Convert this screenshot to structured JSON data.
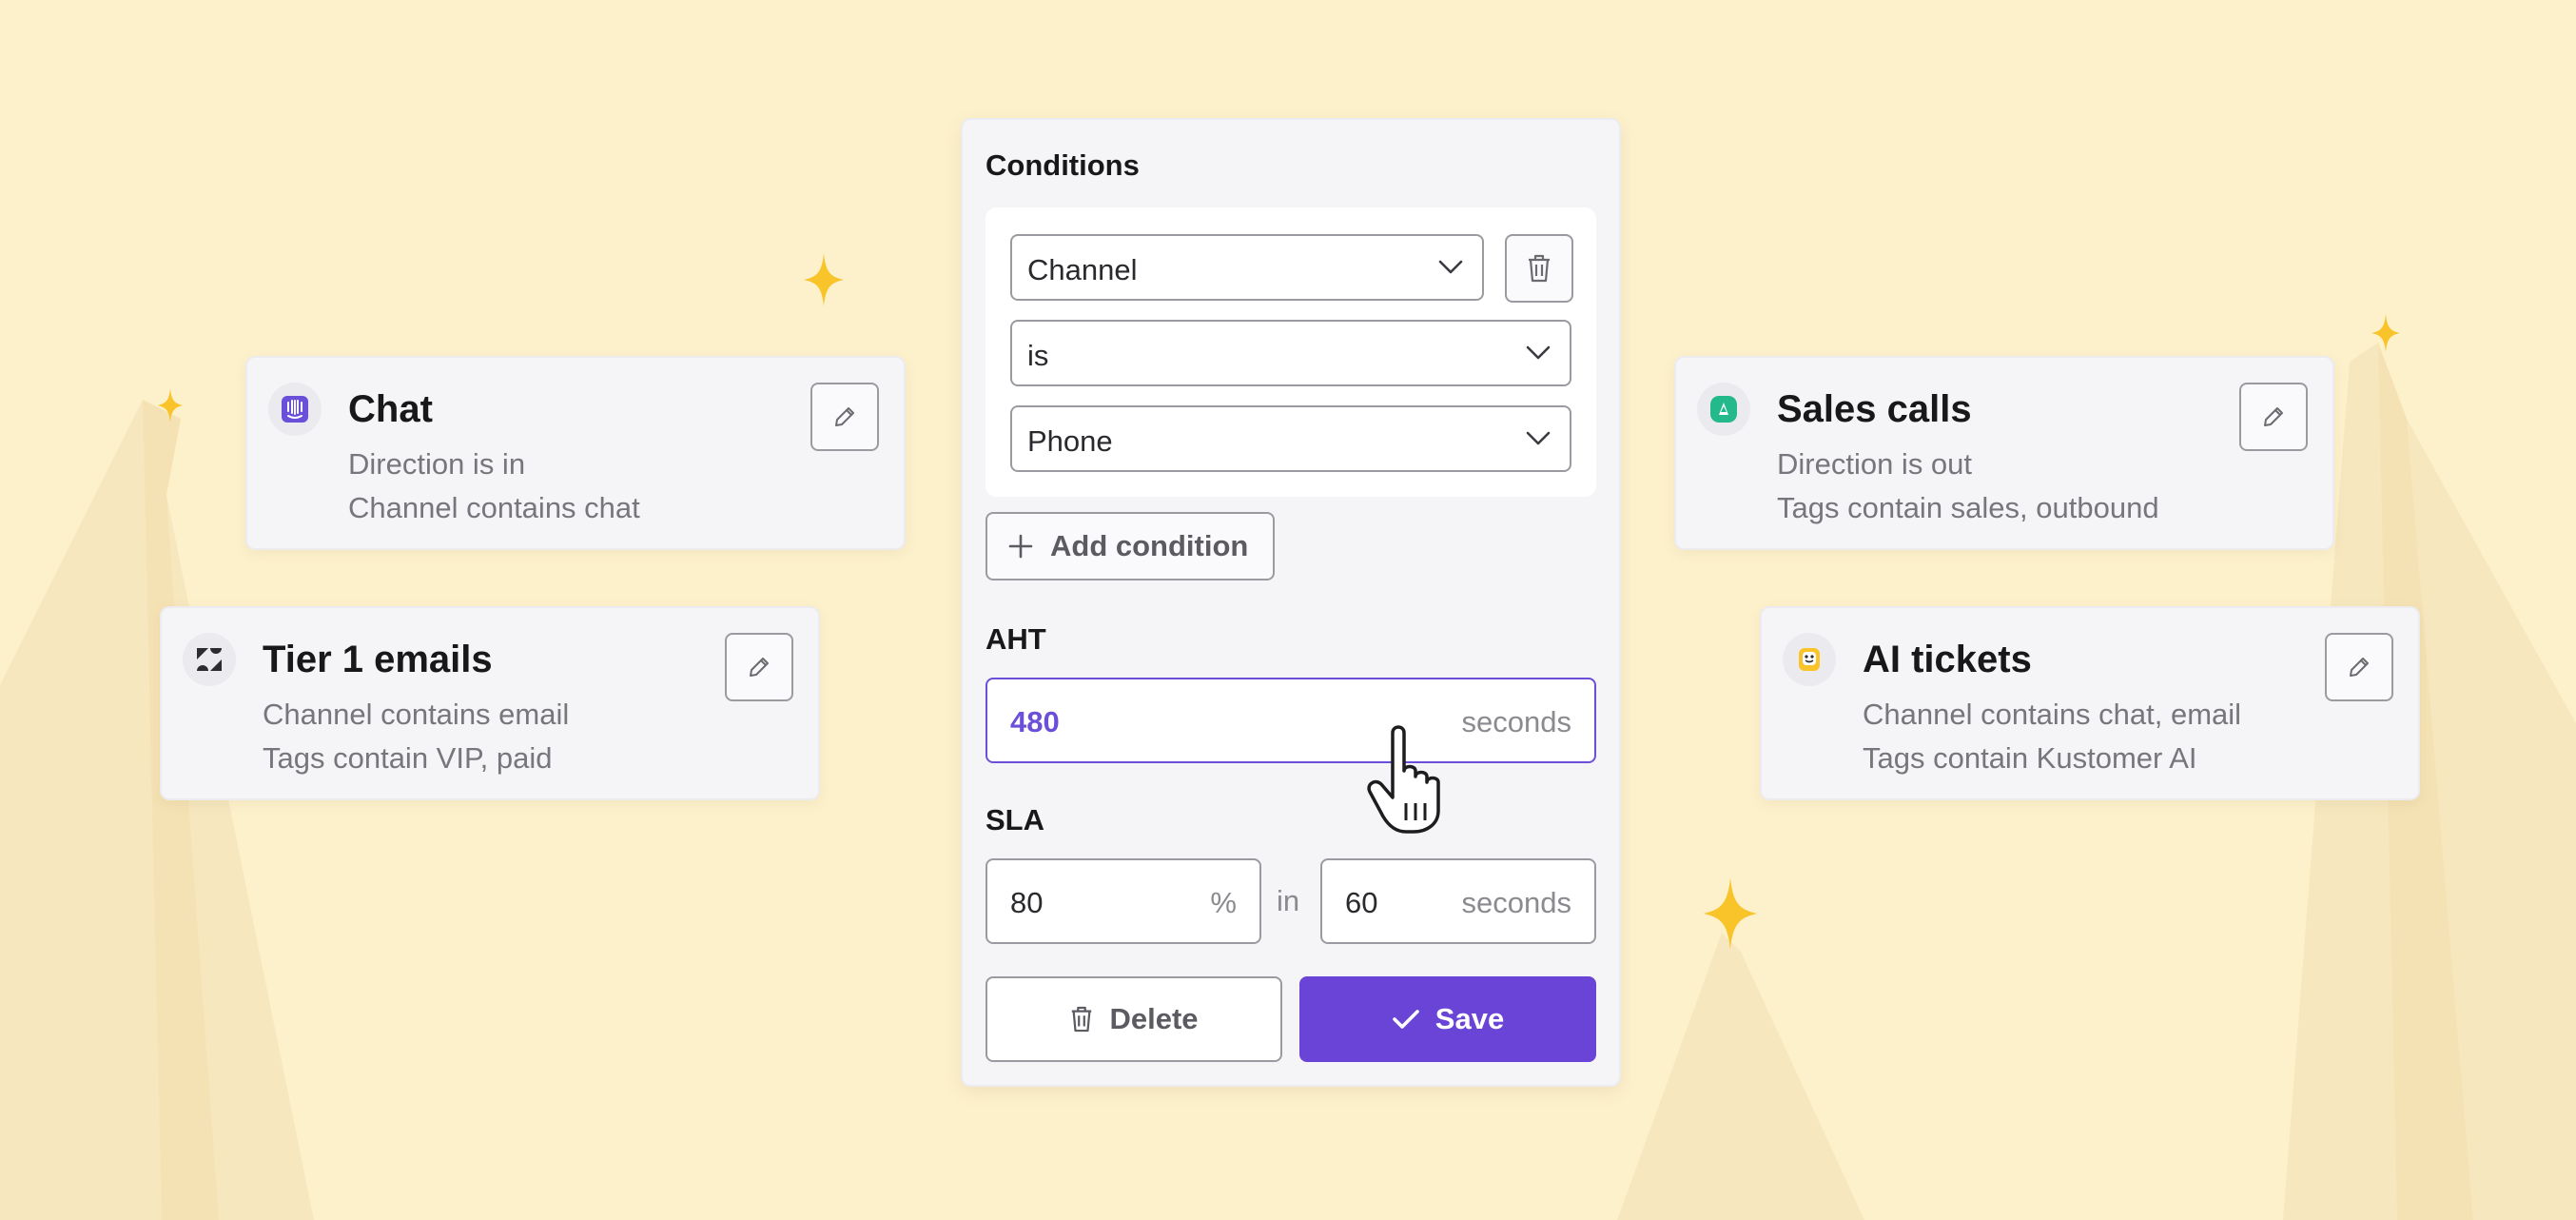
{
  "colors": {
    "background": "#fdf1cc",
    "accent": "#6a44d6",
    "sparkle": "#f8c42a",
    "card": "#f5f5f8"
  },
  "cards": [
    {
      "title": "Chat",
      "line1": "Direction is in",
      "line2": "Channel contains chat",
      "logo_icon": "intercom-logo-icon"
    },
    {
      "title": "Tier 1 emails",
      "line1": "Channel contains email",
      "line2": "Tags contain VIP, paid",
      "logo_icon": "zendesk-logo-icon"
    },
    {
      "title": "Sales calls",
      "line1": "Direction is out",
      "line2": "Tags contain sales, outbound",
      "logo_icon": "aircall-logo-icon"
    },
    {
      "title": "AI tickets",
      "line1": "Channel contains chat, email",
      "line2": "Tags contain Kustomer AI",
      "logo_icon": "kustomer-logo-icon"
    }
  ],
  "panel": {
    "heading": "Conditions",
    "conditions": {
      "field": "Channel",
      "operator": "is",
      "value": "Phone"
    },
    "add_condition": "Add condition",
    "aht_label": "AHT",
    "aht_value": "480",
    "aht_unit": "seconds",
    "sla_label": "SLA",
    "sla_percent": "80",
    "sla_percent_unit": "%",
    "sla_in": "in",
    "sla_seconds": "60",
    "sla_seconds_unit": "seconds",
    "delete_label": "Delete",
    "save_label": "Save"
  }
}
